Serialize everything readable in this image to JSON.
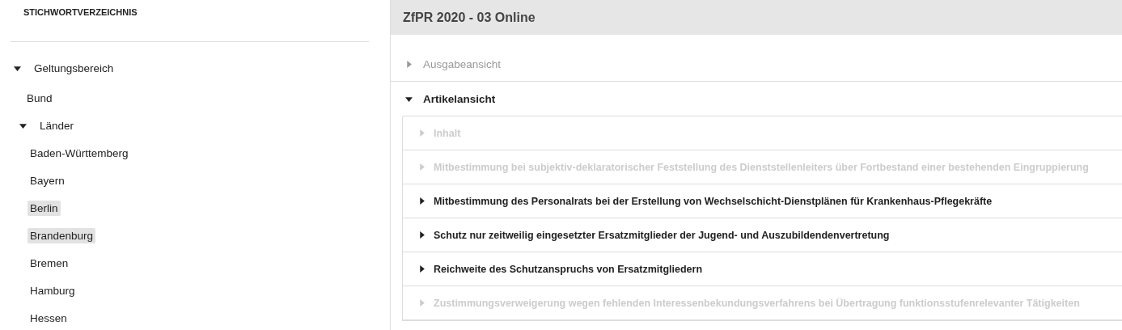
{
  "sidebar": {
    "title": "STICHWORTVERZEICHNIS",
    "tree": [
      {
        "label": "Geltungsbereich",
        "expanded": true,
        "selected": false,
        "children": [
          {
            "label": "Bund",
            "selected": false
          },
          {
            "label": "Länder",
            "expanded": true,
            "selected": false,
            "children": [
              {
                "label": "Baden-Württemberg",
                "selected": false
              },
              {
                "label": "Bayern",
                "selected": false
              },
              {
                "label": "Berlin",
                "selected": true
              },
              {
                "label": "Brandenburg",
                "selected": true
              },
              {
                "label": "Bremen",
                "selected": false
              },
              {
                "label": "Hamburg",
                "selected": false
              },
              {
                "label": "Hessen",
                "selected": false
              }
            ]
          }
        ]
      }
    ]
  },
  "main": {
    "title": "ZfPR 2020 - 03 Online",
    "sections": [
      {
        "label": "Ausgabeansicht",
        "expanded": false,
        "disabled": true
      },
      {
        "label": "Artikelansicht",
        "expanded": true,
        "disabled": false,
        "items": [
          {
            "label": "Inhalt",
            "disabled": true
          },
          {
            "label": "Mitbestimmung bei subjektiv-deklaratorischer Feststellung des Dienststellenleiters über Fortbestand einer bestehenden Eingruppierung",
            "disabled": true
          },
          {
            "label": "Mitbestimmung des Personalrats bei der Erstellung von Wechselschicht-Dienstplänen für Krankenhaus-Pflegekräfte",
            "disabled": false
          },
          {
            "label": "Schutz nur zeitweilig eingesetzter Ersatzmitglieder der Jugend- und Auszubildendenvertretung",
            "disabled": false
          },
          {
            "label": "Reichweite des Schutzanspruchs von Ersatzmitgliedern",
            "disabled": false
          },
          {
            "label": "Zustimmungsverweigerung wegen fehlenden Interessenbekundungsverfahrens bei Übertragung funktionsstufenrelevanter Tätigkeiten",
            "disabled": true
          }
        ]
      }
    ]
  }
}
